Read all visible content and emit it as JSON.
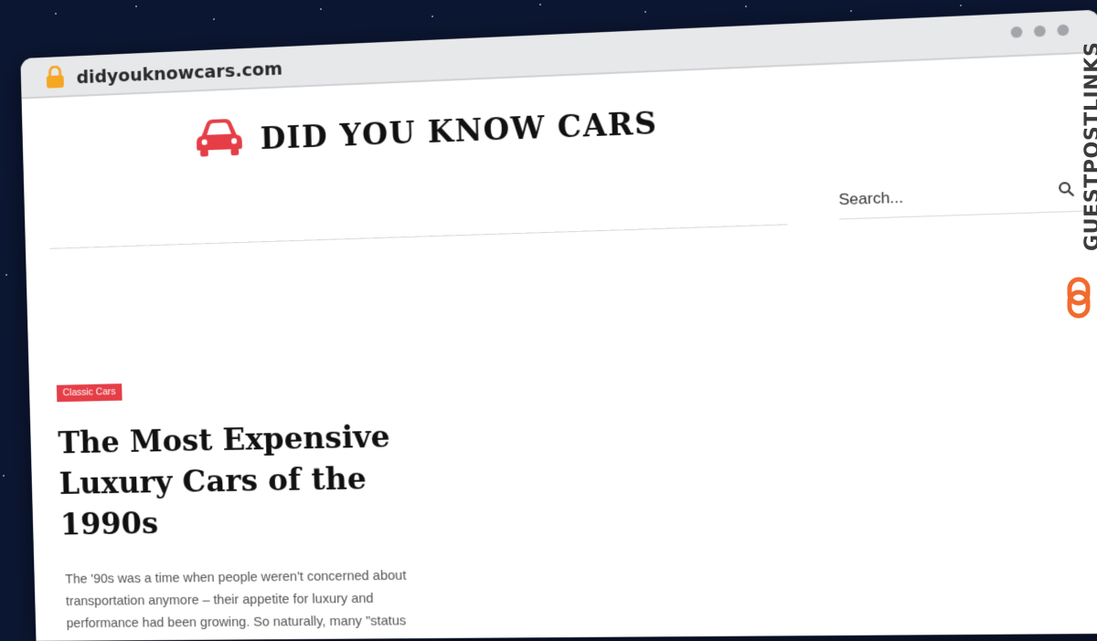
{
  "browser": {
    "url": "didyouknowcars.com"
  },
  "site": {
    "title": "DID YOU KNOW CARS",
    "logo_icon": "car-icon",
    "accent_color": "#e53e47"
  },
  "search": {
    "placeholder": "Search..."
  },
  "article": {
    "category": "Classic Cars",
    "title": "The Most Expensive Luxury Cars of the 1990s",
    "excerpt": "The '90s was a time when people weren't concerned about transportation anymore – their appetite for luxury and performance had been growing. So naturally, many \"status"
  },
  "watermark": {
    "text": "GUESTPOSTLINKS",
    "icon": "link-icon",
    "color": "#f26a2e"
  }
}
